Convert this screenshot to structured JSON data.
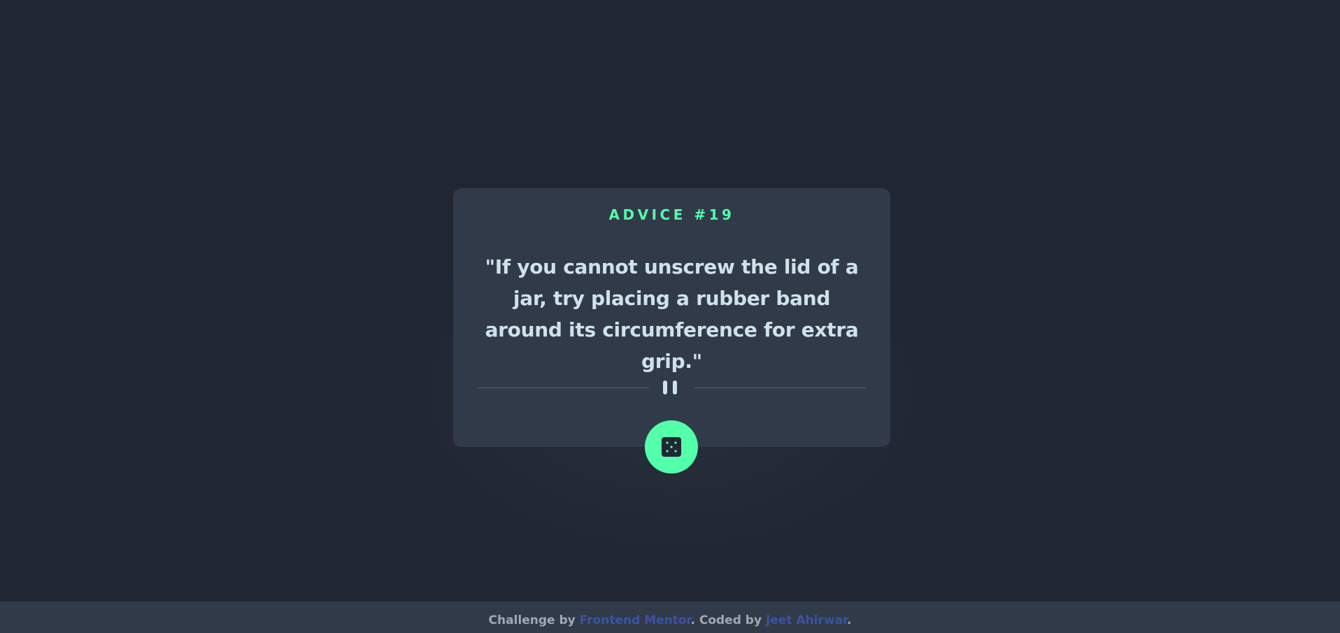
{
  "card": {
    "advice_label": "ADVICE #19",
    "quote": "\"If you cannot unscrew the lid of a jar, try placing a rubber band around its circumference for extra grip.\""
  },
  "icons": {
    "divider": "pause-icon",
    "button": "dice-icon"
  },
  "colors": {
    "background": "#202733",
    "card": "#313a49",
    "accent": "#53ffaa",
    "text": "#cee3e9",
    "link": "#3e52a3",
    "footer_text": "#a3a9b4"
  },
  "footer": {
    "prefix": "Challenge by ",
    "link1": "Frontend Mentor",
    "middle": ". Coded by ",
    "link2": "Jeet Ahirwar",
    "suffix": "."
  }
}
